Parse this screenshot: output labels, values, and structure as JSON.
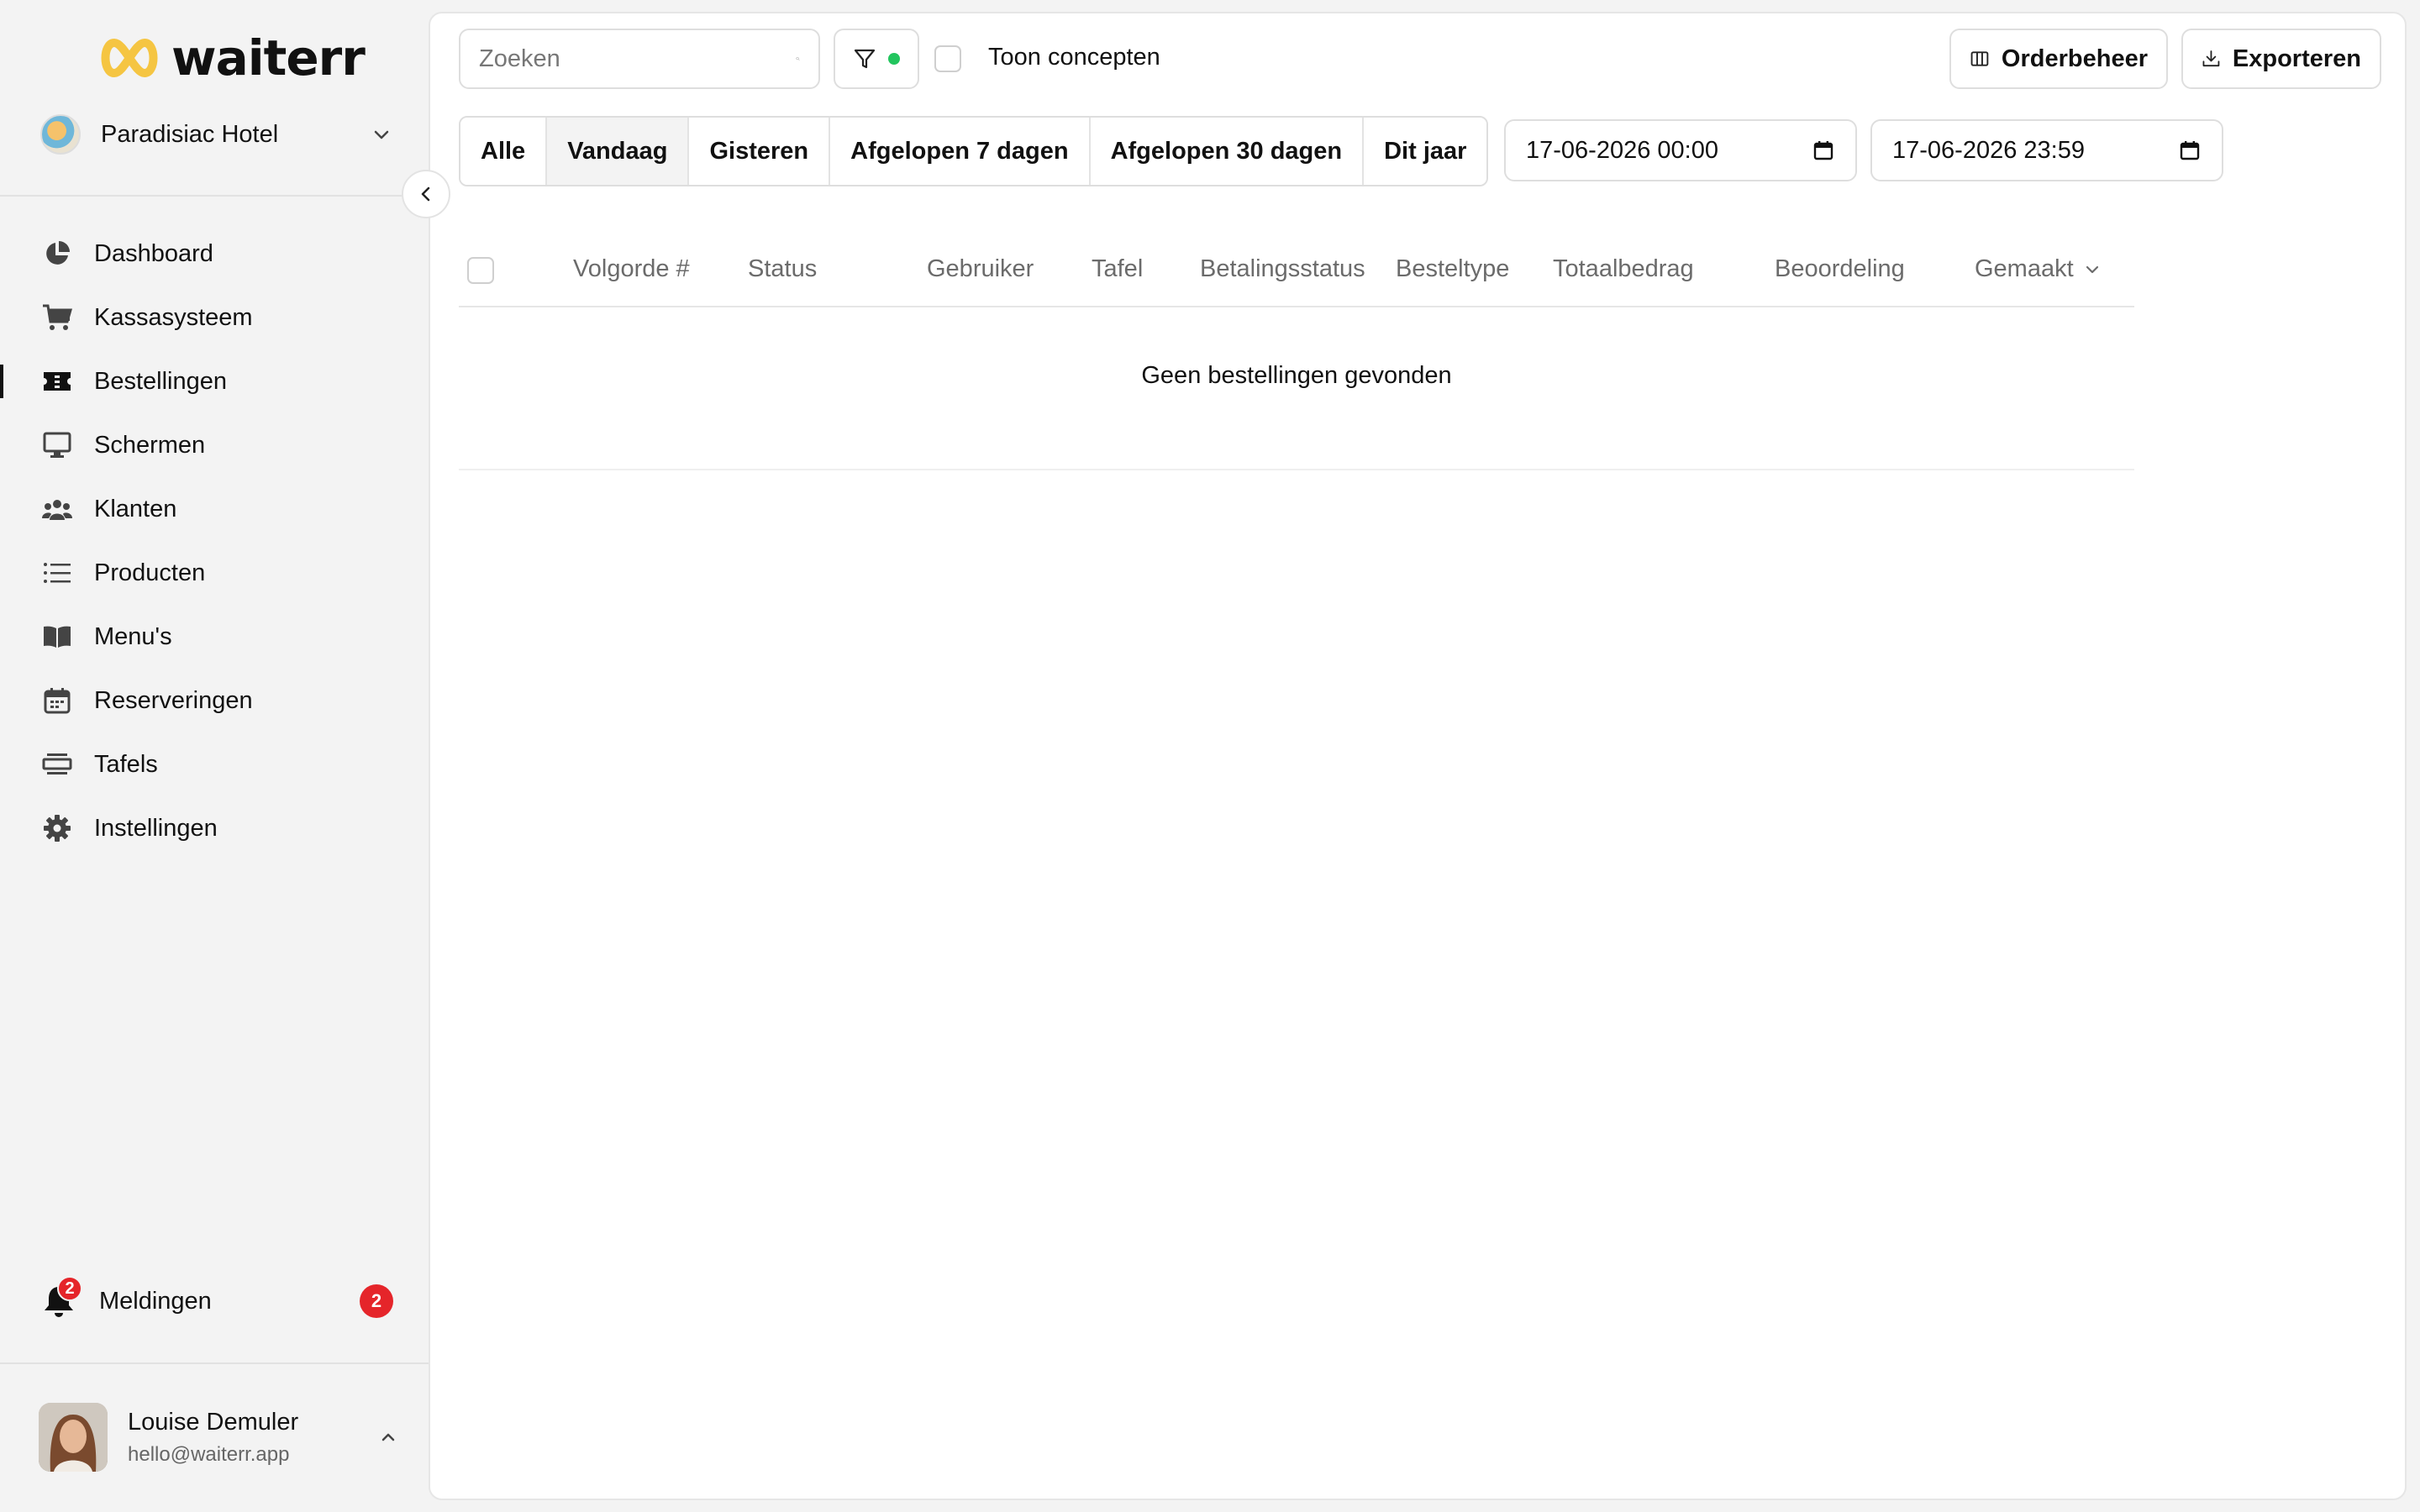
{
  "brand": {
    "name": "waiterr",
    "accent": "#f5c542"
  },
  "venue": {
    "name": "Paradisiac Hotel"
  },
  "sidebar": {
    "items": [
      {
        "label": "Dashboard",
        "icon": "pie-chart-icon"
      },
      {
        "label": "Kassasysteem",
        "icon": "cart-icon"
      },
      {
        "label": "Bestellingen",
        "icon": "ticket-icon",
        "active": true
      },
      {
        "label": "Schermen",
        "icon": "monitor-icon"
      },
      {
        "label": "Klanten",
        "icon": "users-icon"
      },
      {
        "label": "Producten",
        "icon": "list-icon"
      },
      {
        "label": "Menu's",
        "icon": "book-icon"
      },
      {
        "label": "Reserveringen",
        "icon": "calendar-icon"
      },
      {
        "label": "Tafels",
        "icon": "table-icon"
      },
      {
        "label": "Instellingen",
        "icon": "gear-icon"
      }
    ],
    "notifications": {
      "label": "Meldingen",
      "badge": "2",
      "count": "2"
    }
  },
  "user": {
    "name": "Louise Demuler",
    "email": "hello@waiterr.app"
  },
  "toolbar": {
    "search_placeholder": "Zoeken",
    "show_drafts_label": "Toon concepten",
    "filter_status_color": "#22c55e",
    "orders_button": "Orderbeheer",
    "export_button": "Exporteren"
  },
  "ranges": [
    "Alle",
    "Vandaag",
    "Gisteren",
    "Afgelopen 7 dagen",
    "Afgelopen 30 dagen",
    "Dit jaar"
  ],
  "active_range": "Vandaag",
  "date_from": "17-06-2026 00:00",
  "date_to": "17-06-2026 23:59",
  "table": {
    "columns": [
      "Volgorde #",
      "Status",
      "Gebruiker",
      "Tafel",
      "Betalingsstatus",
      "Besteltype",
      "Totaalbedrag",
      "Beoordeling",
      "Gemaakt"
    ],
    "sorted_column": "Gemaakt",
    "empty_message": "Geen bestellingen gevonden"
  }
}
